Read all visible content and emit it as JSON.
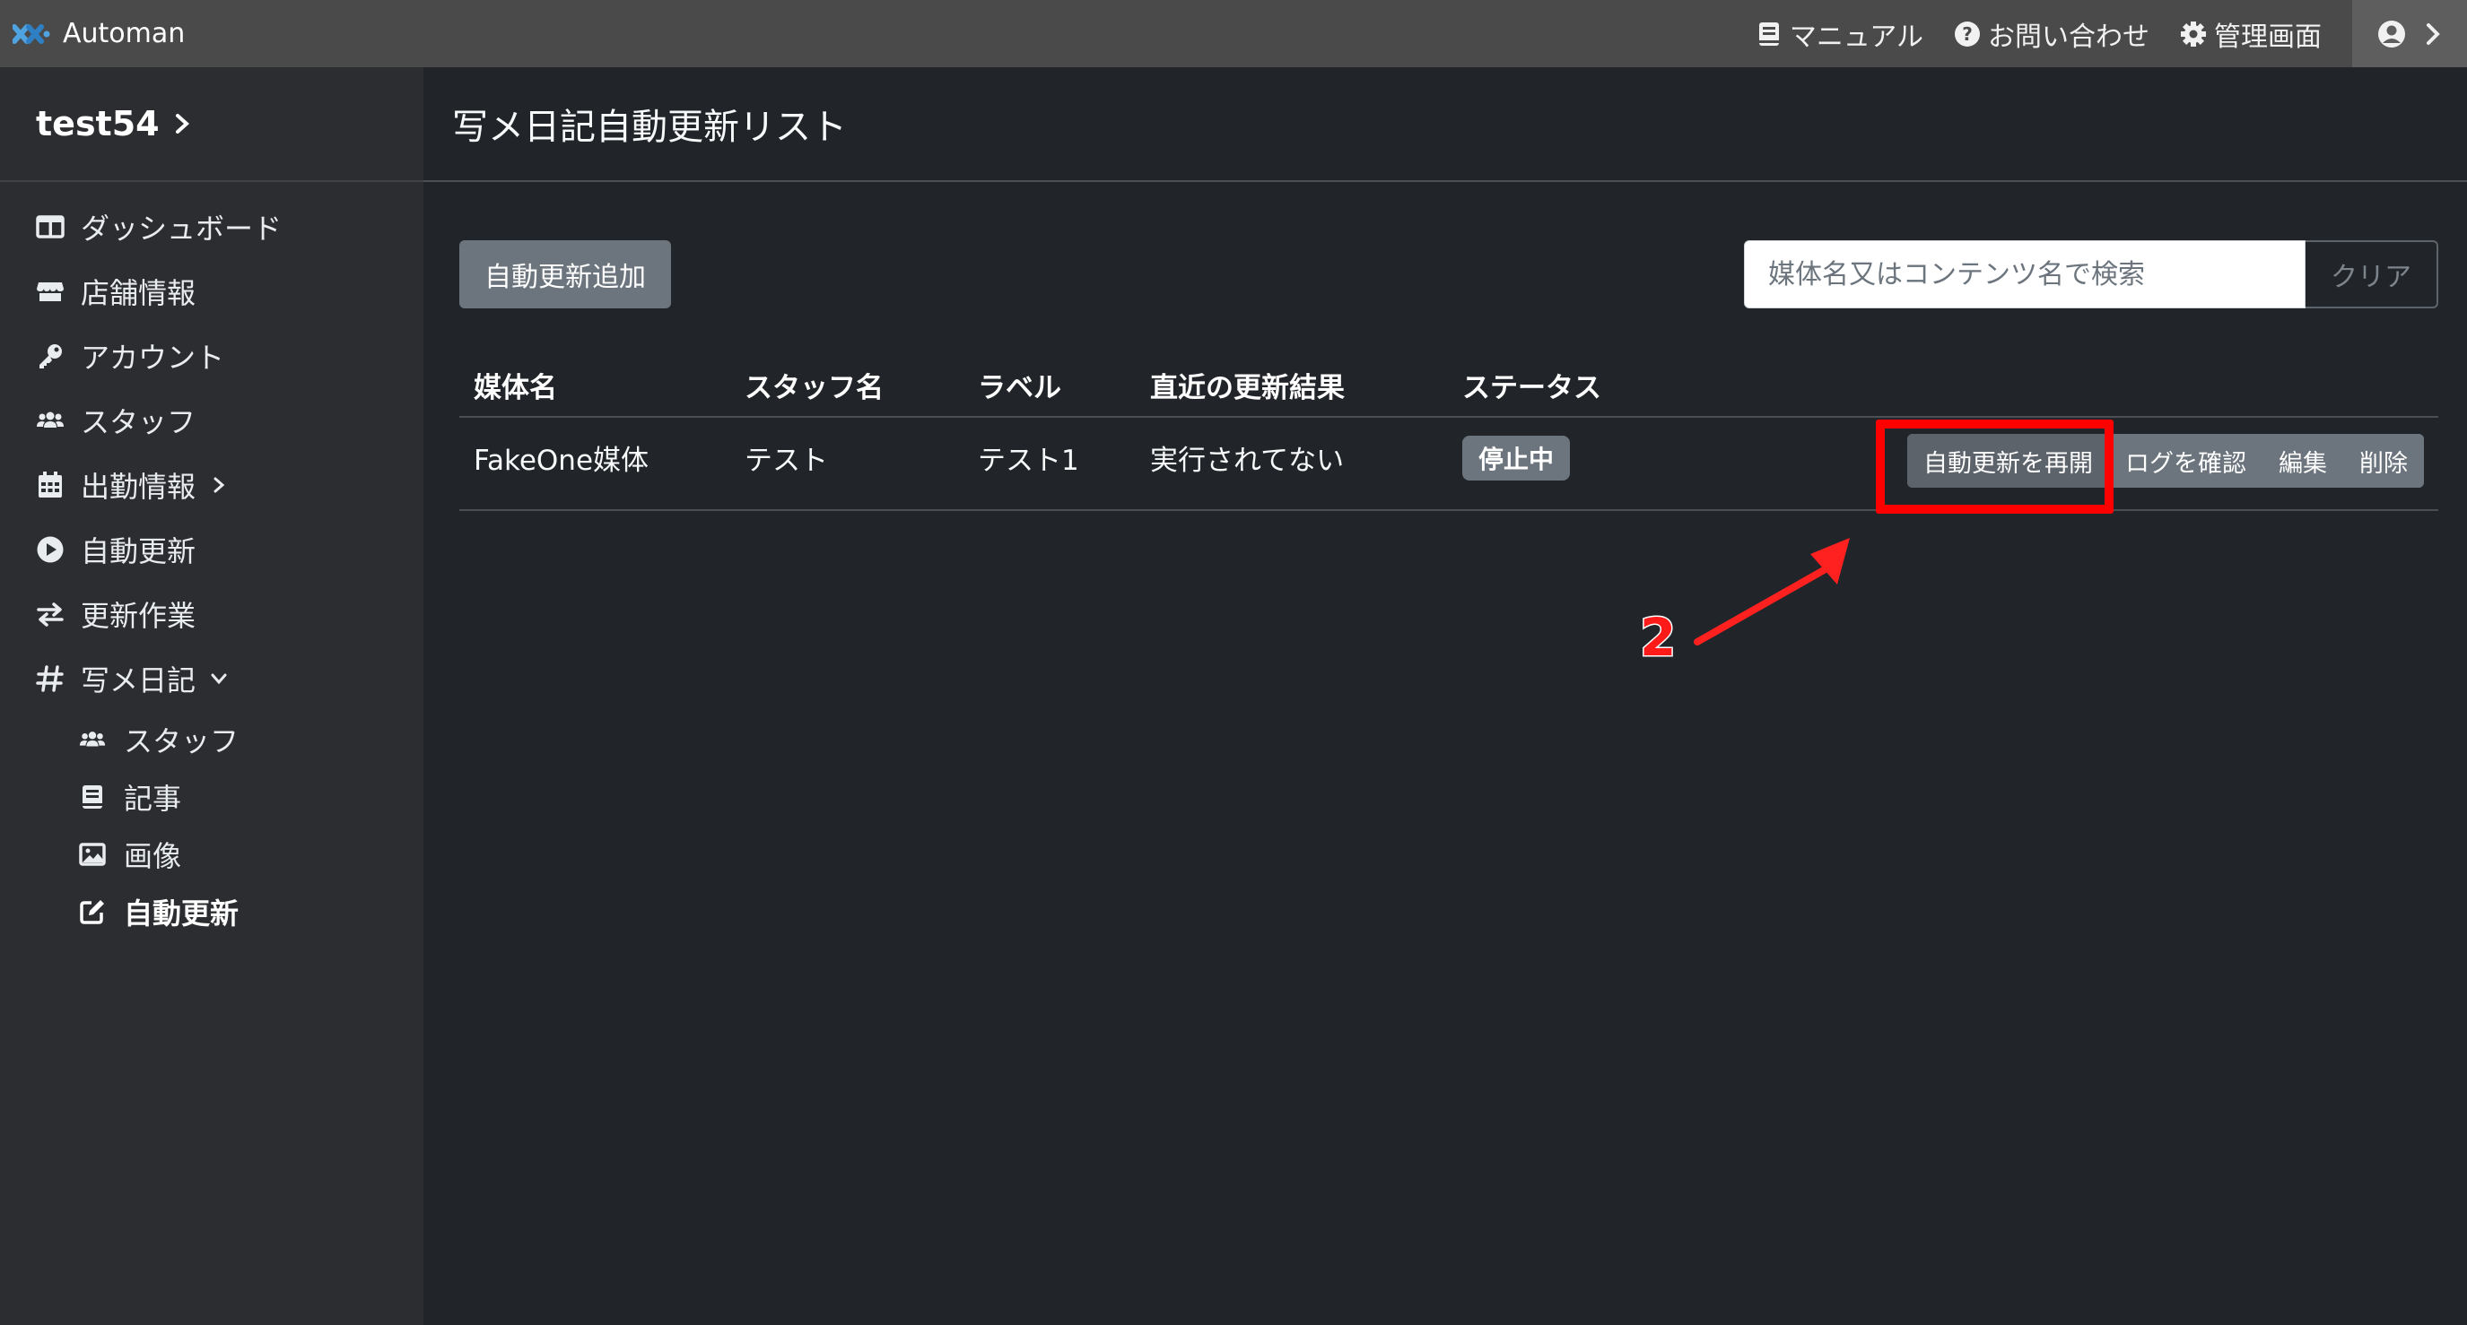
{
  "app": {
    "brand": "Automan",
    "nav_links": [
      {
        "label": "マニュアル",
        "icon": "book-icon"
      },
      {
        "label": "お問い合わせ",
        "icon": "question-icon"
      },
      {
        "label": "管理画面",
        "icon": "gear-icon"
      }
    ]
  },
  "sidebar": {
    "store": "test54",
    "items": [
      {
        "label": "ダッシュボード",
        "icon": "dashboard-icon"
      },
      {
        "label": "店舗情報",
        "icon": "store-icon"
      },
      {
        "label": "アカウント",
        "icon": "key-icon"
      },
      {
        "label": "スタッフ",
        "icon": "users-icon"
      },
      {
        "label": "出勤情報",
        "icon": "calendar-icon"
      },
      {
        "label": "自動更新",
        "icon": "play-circle-icon"
      },
      {
        "label": "更新作業",
        "icon": "exchange-icon"
      },
      {
        "label": "写メ日記",
        "icon": "hashtag-icon"
      }
    ],
    "sub_items": [
      {
        "label": "スタッフ",
        "icon": "users-icon"
      },
      {
        "label": "記事",
        "icon": "book-icon"
      },
      {
        "label": "画像",
        "icon": "image-icon"
      },
      {
        "label": "自動更新",
        "icon": "edit-icon"
      }
    ]
  },
  "main": {
    "title": "写メ日記自動更新リスト",
    "add_button": "自動更新追加",
    "search_placeholder": "媒体名又はコンテンツ名で検索",
    "clear_button": "クリア",
    "columns": [
      "媒体名",
      "スタッフ名",
      "ラベル",
      "直近の更新結果",
      "ステータス"
    ],
    "rows": [
      {
        "media": "FakeOne媒体",
        "staff": "テスト",
        "label": "テスト1",
        "last_result": "実行されてない",
        "status": "停止中",
        "actions": [
          "自動更新を再開",
          "ログを確認",
          "編集",
          "削除"
        ]
      }
    ]
  },
  "annotation": {
    "step": "2",
    "color": "#ff0000"
  }
}
